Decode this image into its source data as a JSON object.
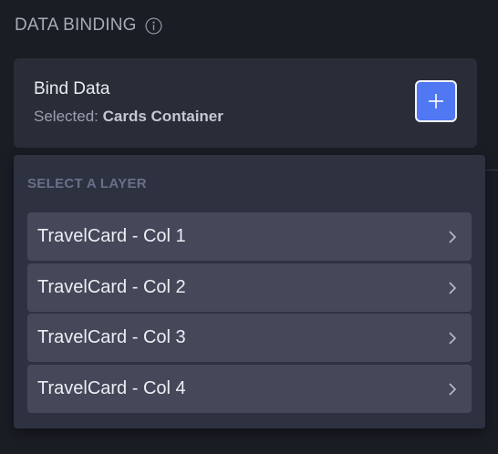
{
  "section": {
    "title": "DATA BINDING",
    "info_icon": "info-icon"
  },
  "bind_card": {
    "title": "Bind Data",
    "selected_prefix": "Selected:",
    "selected_value": "Cards Container",
    "add_icon": "plus-icon"
  },
  "layer_dropdown": {
    "label": "SELECT A LAYER",
    "items": [
      {
        "label": "TravelCard - Col 1",
        "icon": "chevron-right-icon"
      },
      {
        "label": "TravelCard - Col 2",
        "icon": "chevron-right-icon"
      },
      {
        "label": "TravelCard - Col 3",
        "icon": "chevron-right-icon"
      },
      {
        "label": "TravelCard - Col 4",
        "icon": "chevron-right-icon"
      }
    ]
  },
  "colors": {
    "background": "#1b1d25",
    "card": "#2a2d38",
    "panel": "#2e3140",
    "item": "#444858",
    "accent": "#4f78f2"
  }
}
